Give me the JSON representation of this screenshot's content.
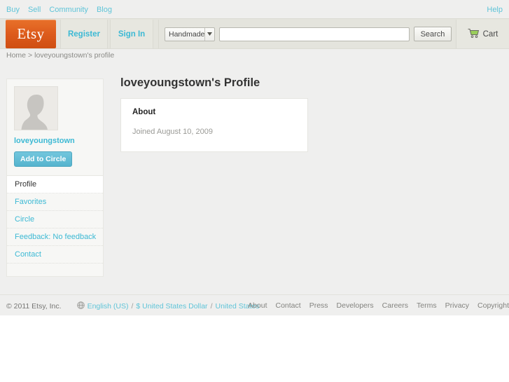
{
  "topnav": {
    "links": [
      {
        "label": "Buy"
      },
      {
        "label": "Sell"
      },
      {
        "label": "Community"
      },
      {
        "label": "Blog"
      }
    ],
    "help_label": "Help"
  },
  "header": {
    "logo_text": "Etsy",
    "register_label": "Register",
    "signin_label": "Sign In",
    "search": {
      "category_label": "Handmade",
      "input_value": "",
      "input_placeholder": "",
      "button_label": "Search"
    },
    "cart_label": "Cart"
  },
  "breadcrumb": {
    "home_label": "Home",
    "separator": ">",
    "current_label": "loveyoungstown's profile"
  },
  "main": {
    "page_title": "loveyoungstown's Profile",
    "about": {
      "title": "About",
      "joined": "Joined August 10, 2009"
    }
  },
  "sidebar": {
    "username": "loveyoungstown",
    "circle_button_label": "Add to Circle",
    "nav_items": [
      {
        "label": "Profile",
        "active": true
      },
      {
        "label": "Favorites",
        "active": false
      },
      {
        "label": "Circle",
        "active": false
      },
      {
        "label": "Feedback: No feedback",
        "active": false
      },
      {
        "label": "Contact",
        "active": false
      }
    ]
  },
  "footer": {
    "copyright": "© 2011 Etsy, Inc.",
    "locale": {
      "language": "English (US)",
      "currency": "$ United States Dollar",
      "region": "United States",
      "separator": "/"
    },
    "links": [
      {
        "label": "About"
      },
      {
        "label": "Contact"
      },
      {
        "label": "Press"
      },
      {
        "label": "Developers"
      },
      {
        "label": "Careers"
      },
      {
        "label": "Terms"
      },
      {
        "label": "Privacy"
      },
      {
        "label": "Copyright"
      }
    ]
  },
  "colors": {
    "brand_orange": "#dd5b1c",
    "link_blue": "#5fc4d8",
    "accent_blue": "#3cb9d4",
    "page_bg": "#efefee"
  }
}
